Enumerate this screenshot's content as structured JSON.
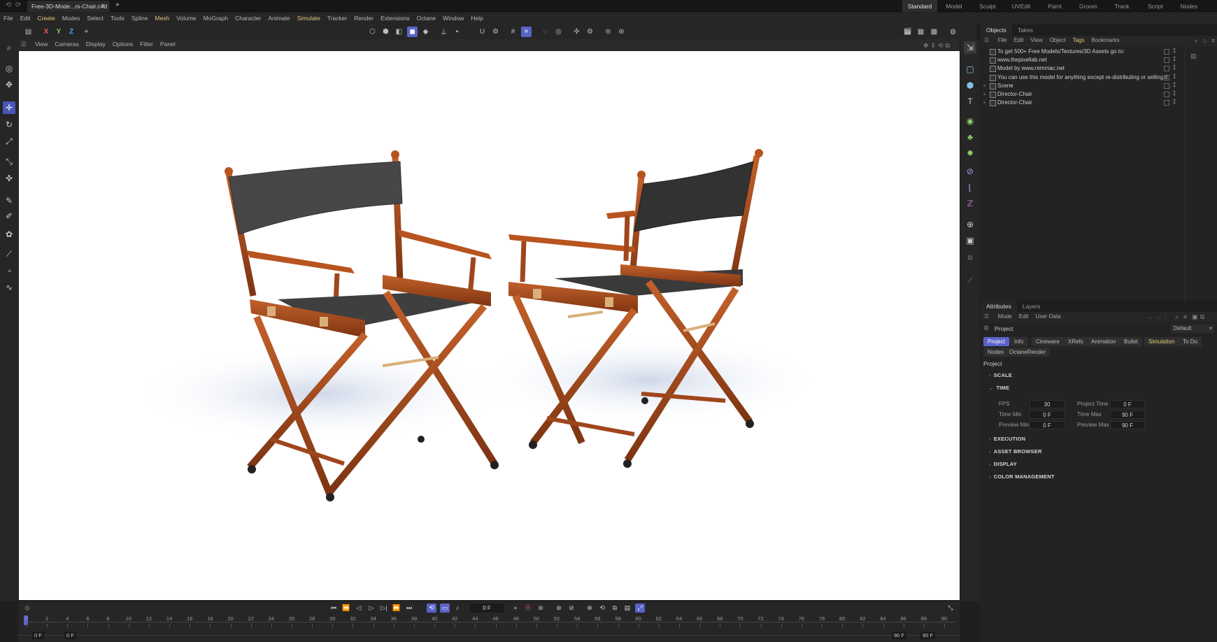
{
  "titlebar": {
    "file_tab": "Free-3D-Mode...rs-Chair.c4d",
    "close_glyph": "✕",
    "add_glyph": "+",
    "layouts": [
      "Standard",
      "Model",
      "Sculpt",
      "UVEdit",
      "Paint",
      "Groom",
      "Track",
      "Script",
      "Nodes"
    ],
    "active_layout": "Standard"
  },
  "menubar": [
    "File",
    "Edit",
    "Create",
    "Modes",
    "Select",
    "Tools",
    "Spline",
    "Mesh",
    "Volume",
    "MoGraph",
    "Character",
    "Animate",
    "Simulate",
    "Tracker",
    "Render",
    "Extensions",
    "Octane",
    "Window",
    "Help"
  ],
  "menubar_highlight": [
    "Create",
    "Mesh",
    "Simulate"
  ],
  "toolbar": {
    "axes": [
      "X",
      "Y",
      "Z"
    ],
    "axis_colors": [
      "#e05a5a",
      "#8bd14d",
      "#5aa0ff"
    ]
  },
  "viewport_menu": [
    "View",
    "Cameras",
    "Display",
    "Options",
    "Filter",
    "Panel"
  ],
  "objects_panel": {
    "tabs": [
      "Objects",
      "Takes"
    ],
    "menu": [
      "File",
      "Edit",
      "View",
      "Object",
      "Tags",
      "Bookmarks"
    ],
    "menu_highlight": "Tags",
    "rows": [
      {
        "label": "To get 500+ Free Models/Textures/3D Assets go to:",
        "expandable": false
      },
      {
        "label": "www.thepixellab.net",
        "expandable": false
      },
      {
        "label": "Model by www.remmac.net",
        "expandable": false
      },
      {
        "label": "You can use this model for anything except re-distributing or selling it",
        "expandable": false
      },
      {
        "label": "Scene",
        "expandable": true
      },
      {
        "label": "Director-Chair",
        "expandable": true
      },
      {
        "label": "Director-Chair",
        "expandable": true
      }
    ]
  },
  "attributes_panel": {
    "tabs": [
      "Attributes",
      "Layers"
    ],
    "menu": [
      "Mode",
      "Edit",
      "User Data"
    ],
    "object_name": "Project",
    "preset": "Default",
    "tab_pills_row1": [
      "Project",
      "Info",
      "Cineware",
      "XRefs",
      "Animation",
      "Bullet",
      "Simulation",
      "To Do"
    ],
    "tab_pills_row2": [
      "Nodes",
      "OctaneRender"
    ],
    "active_pill": "Project",
    "highlight_pill": "Simulation",
    "section_title": "Project",
    "sections": [
      "SCALE",
      "TIME",
      "EXECUTION",
      "ASSET BROWSER",
      "DISPLAY",
      "COLOR MANAGEMENT"
    ],
    "time_fields": {
      "fps_label": "FPS",
      "fps": "30",
      "project_time_label": "Project Time",
      "project_time": "0 F",
      "time_min_label": "Time Min",
      "time_min": "0 F",
      "time_max_label": "Time Max",
      "time_max": "90 F",
      "preview_min_label": "Preview Min",
      "preview_min": "0 F",
      "preview_max_label": "Preview Max",
      "preview_max": "90 F"
    }
  },
  "timeline": {
    "current_frame": "0 F",
    "ruler_ticks": [
      "0",
      "2",
      "4",
      "6",
      "8",
      "10",
      "12",
      "14",
      "16",
      "18",
      "20",
      "22",
      "24",
      "26",
      "28",
      "30",
      "32",
      "34",
      "36",
      "38",
      "40",
      "42",
      "44",
      "46",
      "48",
      "50",
      "52",
      "54",
      "56",
      "58",
      "60",
      "62",
      "64",
      "66",
      "68",
      "70",
      "72",
      "74",
      "76",
      "78",
      "80",
      "82",
      "84",
      "86",
      "88",
      "90"
    ],
    "start_a": "0 F",
    "start_b": "0 F",
    "end_a": "90 F",
    "end_b": "90 F"
  },
  "colors": {
    "accent": "#5a63c8",
    "highlight_text": "#e1c979",
    "chair_wood": "#a0461c",
    "chair_fabric": "#3a3a3a"
  }
}
